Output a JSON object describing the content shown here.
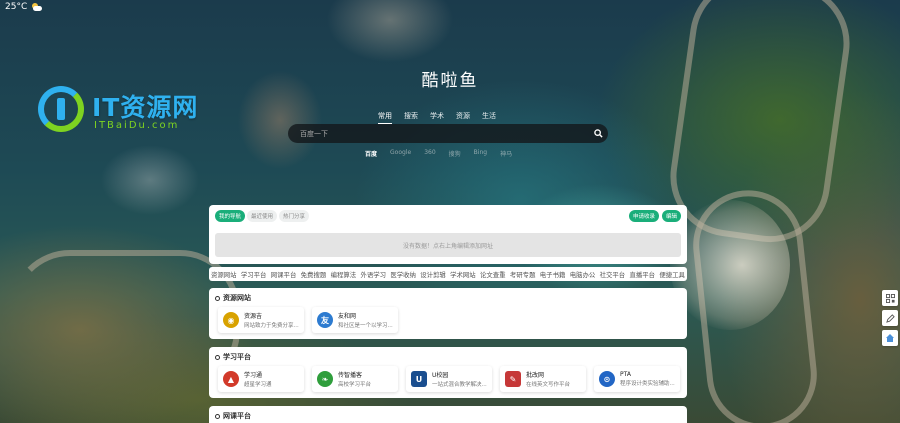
{
  "weather": {
    "temperature": "25°C",
    "icon": "partly-cloudy-icon"
  },
  "logo": {
    "brand": "IT资源网",
    "sub": "ITBaiDu.com"
  },
  "site_title": "酷啦鱼",
  "search": {
    "tabs": [
      "常用",
      "搜索",
      "学术",
      "资源",
      "生活"
    ],
    "active_tab": 0,
    "placeholder": "百度一下",
    "engines": [
      "百度",
      "Google",
      "360",
      "搜狗",
      "Bing",
      "神马"
    ],
    "active_engine": 0
  },
  "quick": {
    "tabs": [
      "我的导航",
      "最近使用",
      "热门分享"
    ],
    "active_tab": 0,
    "apply_label": "申请收录",
    "edit_label": "编辑",
    "empty_text": "没有数据！点右上角编辑添加网址"
  },
  "categories": [
    "资源网站",
    "学习平台",
    "网课平台",
    "免费搜题",
    "编程算法",
    "外语学习",
    "医学收纳",
    "设计剪辑",
    "学术网站",
    "论文查重",
    "考研专题",
    "电子书籍",
    "电脑办公",
    "社交平台",
    "直播平台",
    "便捷工具"
  ],
  "sections": [
    {
      "title": "资源网站",
      "items": [
        {
          "name": "资源吉",
          "desc": "网站致力于免费分享...",
          "color": "#d8a200",
          "glyph": "◉"
        },
        {
          "name": "友和网",
          "desc": "和社区是一个以学习...",
          "color": "#2d7bd0",
          "glyph": "友"
        }
      ]
    },
    {
      "title": "学习平台",
      "items": [
        {
          "name": "学习通",
          "desc": "超星学习通",
          "color": "#d23a2a",
          "glyph": "▲"
        },
        {
          "name": "传智播客",
          "desc": "高校学习平台",
          "color": "#2f9e3c",
          "glyph": "❧"
        },
        {
          "name": "U校园",
          "desc": "一站式混合教学解决...",
          "color": "#1a4e8f",
          "glyph": "U"
        },
        {
          "name": "批改网",
          "desc": "在线英文写作平台",
          "color": "#c63838",
          "glyph": "✎"
        },
        {
          "name": "PTA",
          "desc": "程序设计类实验辅助...",
          "color": "#2266c5",
          "glyph": "⊙"
        }
      ]
    },
    {
      "title": "网课平台",
      "items": []
    }
  ],
  "float_buttons": [
    "qrcode-icon",
    "edit-icon",
    "home-icon"
  ]
}
